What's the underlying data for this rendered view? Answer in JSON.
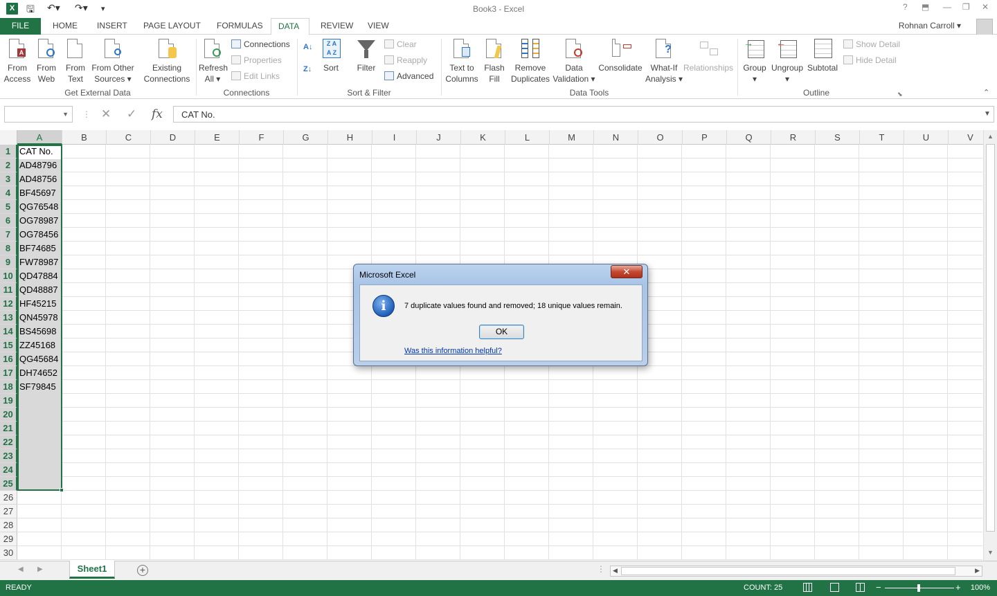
{
  "titlebar": {
    "logo": "X",
    "title": "Book3 - Excel",
    "help": "?",
    "minimize": "—",
    "restore": "❐",
    "close": "✕"
  },
  "tabs": [
    "FILE",
    "HOME",
    "INSERT",
    "PAGE LAYOUT",
    "FORMULAS",
    "DATA",
    "REVIEW",
    "VIEW"
  ],
  "active_tab": "DATA",
  "user": {
    "name": "Rohnan Carroll"
  },
  "ribbon": {
    "get_external_data": {
      "label": "Get External Data",
      "from_access": [
        "From",
        "Access"
      ],
      "from_web": [
        "From",
        "Web"
      ],
      "from_text": [
        "From",
        "Text"
      ],
      "from_other": [
        "From Other",
        "Sources ▾"
      ],
      "existing": [
        "Existing",
        "Connections"
      ]
    },
    "connections": {
      "label": "Connections",
      "refresh": [
        "Refresh",
        "All ▾"
      ],
      "connections": "Connections",
      "properties": "Properties",
      "edit_links": "Edit Links"
    },
    "sort_filter": {
      "label": "Sort & Filter",
      "sort": "Sort",
      "filter": "Filter",
      "clear": "Clear",
      "reapply": "Reapply",
      "advanced": "Advanced"
    },
    "data_tools": {
      "label": "Data Tools",
      "text_to_columns": [
        "Text to",
        "Columns"
      ],
      "flash_fill": [
        "Flash",
        "Fill"
      ],
      "remove_duplicates": [
        "Remove",
        "Duplicates"
      ],
      "data_validation": [
        "Data",
        "Validation ▾"
      ],
      "consolidate": "Consolidate",
      "what_if": [
        "What-If",
        "Analysis ▾"
      ],
      "relationships": "Relationships"
    },
    "outline": {
      "label": "Outline",
      "group": [
        "Group",
        "▾"
      ],
      "ungroup": [
        "Ungroup",
        "▾"
      ],
      "subtotal": "Subtotal",
      "show_detail": "Show Detail",
      "hide_detail": "Hide Detail"
    }
  },
  "formula_bar": {
    "name_box": "",
    "fx": "fx",
    "content": "CAT No."
  },
  "columns": [
    "A",
    "B",
    "C",
    "D",
    "E",
    "F",
    "G",
    "H",
    "I",
    "J",
    "K",
    "L",
    "M",
    "N",
    "O",
    "P",
    "Q",
    "R",
    "S",
    "T",
    "U",
    "V"
  ],
  "rows": [
    "1",
    "2",
    "3",
    "4",
    "5",
    "6",
    "7",
    "8",
    "9",
    "10",
    "11",
    "12",
    "13",
    "14",
    "15",
    "16",
    "17",
    "18",
    "19",
    "20",
    "21",
    "22",
    "23",
    "24",
    "25",
    "26",
    "27",
    "28",
    "29",
    "30"
  ],
  "cells_a": [
    "CAT No.",
    "AD48796",
    "AD48756",
    "BF45697",
    "QG76548",
    "OG78987",
    "OG78456",
    "BF74685",
    "FW78987",
    "QD47884",
    "QD48887",
    "HF45215",
    "QN45978",
    "BS45698",
    "ZZ45168",
    "QG45684",
    "DH74652",
    "SF79845"
  ],
  "sheet": {
    "name": "Sheet1",
    "add": "+"
  },
  "status": {
    "ready": "READY",
    "count": "COUNT: 25",
    "zoom": "100%",
    "minus": "−",
    "plus": "+"
  },
  "dialog": {
    "title": "Microsoft Excel",
    "close": "✕",
    "icon": "i",
    "message": "7 duplicate values found and removed; 18 unique values remain.",
    "ok": "OK",
    "help_link": "Was this information helpful?"
  }
}
